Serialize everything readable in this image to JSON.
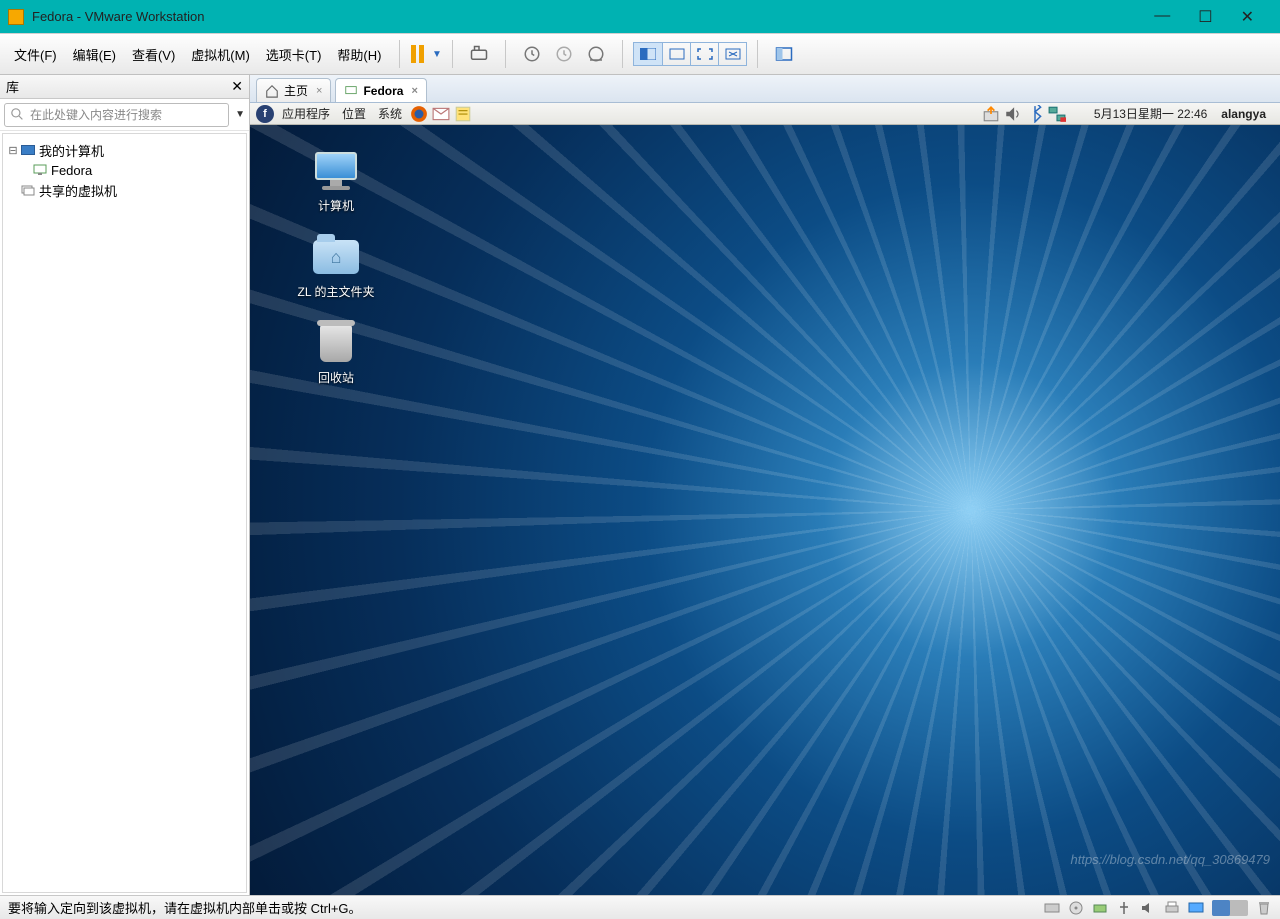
{
  "window": {
    "title": "Fedora - VMware Workstation"
  },
  "menu": {
    "file": "文件(F)",
    "edit": "编辑(E)",
    "view": "查看(V)",
    "vm": "虚拟机(M)",
    "tabs": "选项卡(T)",
    "help": "帮助(H)"
  },
  "library": {
    "title": "库",
    "search_placeholder": "在此处键入内容进行搜索",
    "nodes": {
      "my_computer": "我的计算机",
      "fedora": "Fedora",
      "shared": "共享的虚拟机"
    }
  },
  "tabs": {
    "home": "主页",
    "fedora": "Fedora"
  },
  "gnome": {
    "apps": "应用程序",
    "places": "位置",
    "system": "系统",
    "datetime": "5月13日星期一 22:46",
    "user": "alangya"
  },
  "desktop": {
    "computer": "计算机",
    "home_folder": "ZL 的主文件夹",
    "trash": "回收站"
  },
  "status": {
    "hint": "要将输入定向到该虚拟机，请在虚拟机内部单击或按 Ctrl+G。"
  },
  "watermark": "https://blog.csdn.net/qq_30869479"
}
